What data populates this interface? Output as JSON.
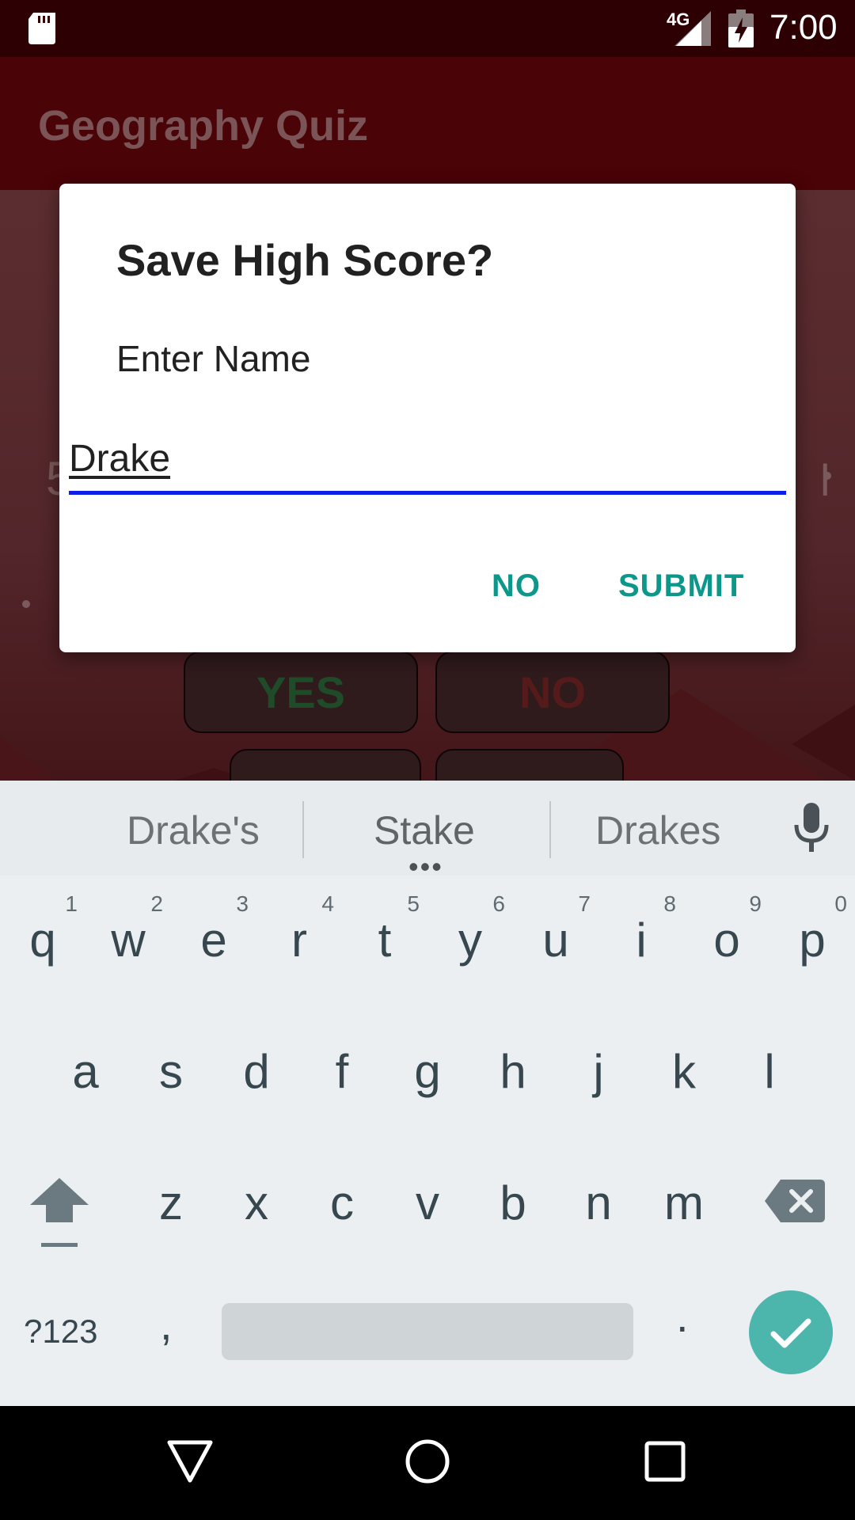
{
  "status_bar": {
    "network": "4G",
    "time": "7:00",
    "icons": [
      "sd-card-icon",
      "signal-icon",
      "battery-charging-icon"
    ]
  },
  "app_bar": {
    "title": "Geography Quiz"
  },
  "background": {
    "yes_label": "YES",
    "no_label": "NO",
    "left_partial": "5",
    "right_partial": "l"
  },
  "dialog": {
    "title": "Save High Score?",
    "message": "Enter Name",
    "input_value": "Drake",
    "no_label": "NO",
    "submit_label": "SUBMIT"
  },
  "keyboard": {
    "suggestions": [
      "Drake's",
      "Stake",
      "Drakes"
    ],
    "more_indicator": "•••",
    "row1": [
      {
        "key": "q",
        "hint": "1"
      },
      {
        "key": "w",
        "hint": "2"
      },
      {
        "key": "e",
        "hint": "3"
      },
      {
        "key": "r",
        "hint": "4"
      },
      {
        "key": "t",
        "hint": "5"
      },
      {
        "key": "y",
        "hint": "6"
      },
      {
        "key": "u",
        "hint": "7"
      },
      {
        "key": "i",
        "hint": "8"
      },
      {
        "key": "o",
        "hint": "9"
      },
      {
        "key": "p",
        "hint": "0"
      }
    ],
    "row2": [
      "a",
      "s",
      "d",
      "f",
      "g",
      "h",
      "j",
      "k",
      "l"
    ],
    "row3": [
      "z",
      "x",
      "c",
      "v",
      "b",
      "n",
      "m"
    ],
    "symbols_label": "?123",
    "comma": ",",
    "period": ".",
    "accent_color": "#4db6ac"
  },
  "nav_bar": {
    "icons": [
      "back-icon",
      "home-icon",
      "recents-icon"
    ]
  },
  "colors": {
    "app_bar": "#4a0307",
    "input_focus": "#0d1ee6",
    "dialog_button": "#0d968a"
  }
}
